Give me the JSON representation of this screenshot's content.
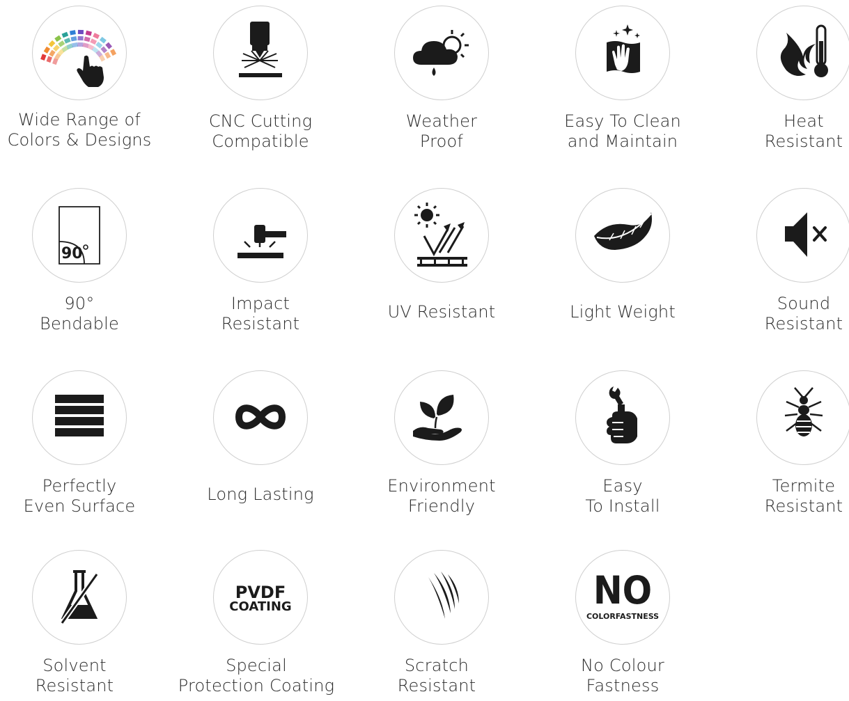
{
  "features": [
    {
      "icon": "color-palette-icon",
      "lines": [
        "Wide Range of",
        "Colors & Designs"
      ]
    },
    {
      "icon": "cnc-cutting-icon",
      "lines": [
        "CNC Cutting",
        "Compatible"
      ]
    },
    {
      "icon": "weather-icon",
      "lines": [
        "Weather",
        "Proof"
      ]
    },
    {
      "icon": "cleaning-hand-icon",
      "lines": [
        "Easy To Clean",
        "and Maintain"
      ]
    },
    {
      "icon": "heat-thermometer-icon",
      "lines": [
        "Heat",
        "Resistant"
      ]
    },
    {
      "icon": "bend-90-icon",
      "lines": [
        "90°",
        "Bendable"
      ],
      "icon_text": "90"
    },
    {
      "icon": "hammer-impact-icon",
      "lines": [
        "Impact",
        "Resistant"
      ]
    },
    {
      "icon": "uv-sun-icon",
      "lines": [
        "UV Resistant"
      ]
    },
    {
      "icon": "feather-icon",
      "lines": [
        "Light Weight"
      ]
    },
    {
      "icon": "speaker-mute-icon",
      "lines": [
        "Sound",
        "Resistant"
      ]
    },
    {
      "icon": "even-surface-icon",
      "lines": [
        "Perfectly",
        "Even Surface"
      ]
    },
    {
      "icon": "infinity-icon",
      "lines": [
        "Long Lasting"
      ]
    },
    {
      "icon": "leaf-hand-icon",
      "lines": [
        "Environment",
        "Friendly"
      ]
    },
    {
      "icon": "wrench-hand-icon",
      "lines": [
        "Easy",
        "To Install"
      ]
    },
    {
      "icon": "termite-icon",
      "lines": [
        "Termite",
        "Resistant"
      ]
    },
    {
      "icon": "flask-icon",
      "lines": [
        "Solvent",
        "Resistant"
      ]
    },
    {
      "icon": "pvdf-coating-icon",
      "lines": [
        "Special",
        "Protection Coating"
      ],
      "icon_text_lines": [
        "PVDF",
        "COATING"
      ]
    },
    {
      "icon": "scratch-claw-icon",
      "lines": [
        "Scratch",
        "Resistant"
      ]
    },
    {
      "icon": "no-colorfastness-icon",
      "lines": [
        "No Colour",
        "Fastness"
      ],
      "icon_text_lines": [
        "NO",
        "COLORFASTNESS"
      ]
    }
  ]
}
